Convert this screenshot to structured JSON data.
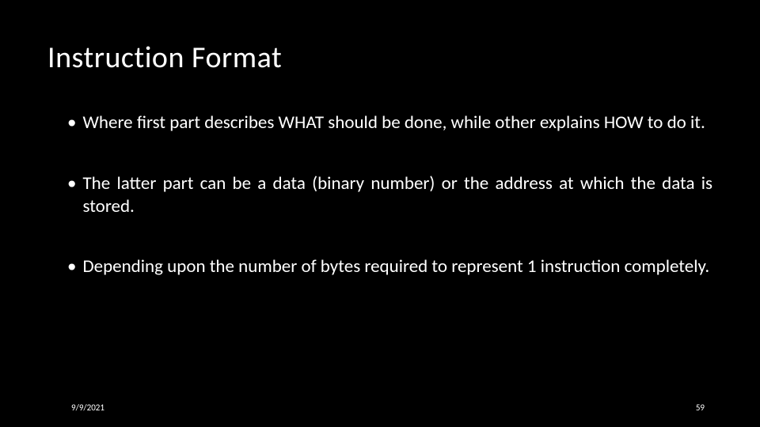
{
  "title": "Instruction Format",
  "bullets": [
    "Where first part describes WHAT should be done, while other explains HOW to do it.",
    "The latter part can be a data (binary number) or the address at which the data is stored.",
    "Depending upon the number of bytes required to represent 1 instruction completely."
  ],
  "footer": {
    "date": "9/9/2021",
    "page": "59"
  }
}
